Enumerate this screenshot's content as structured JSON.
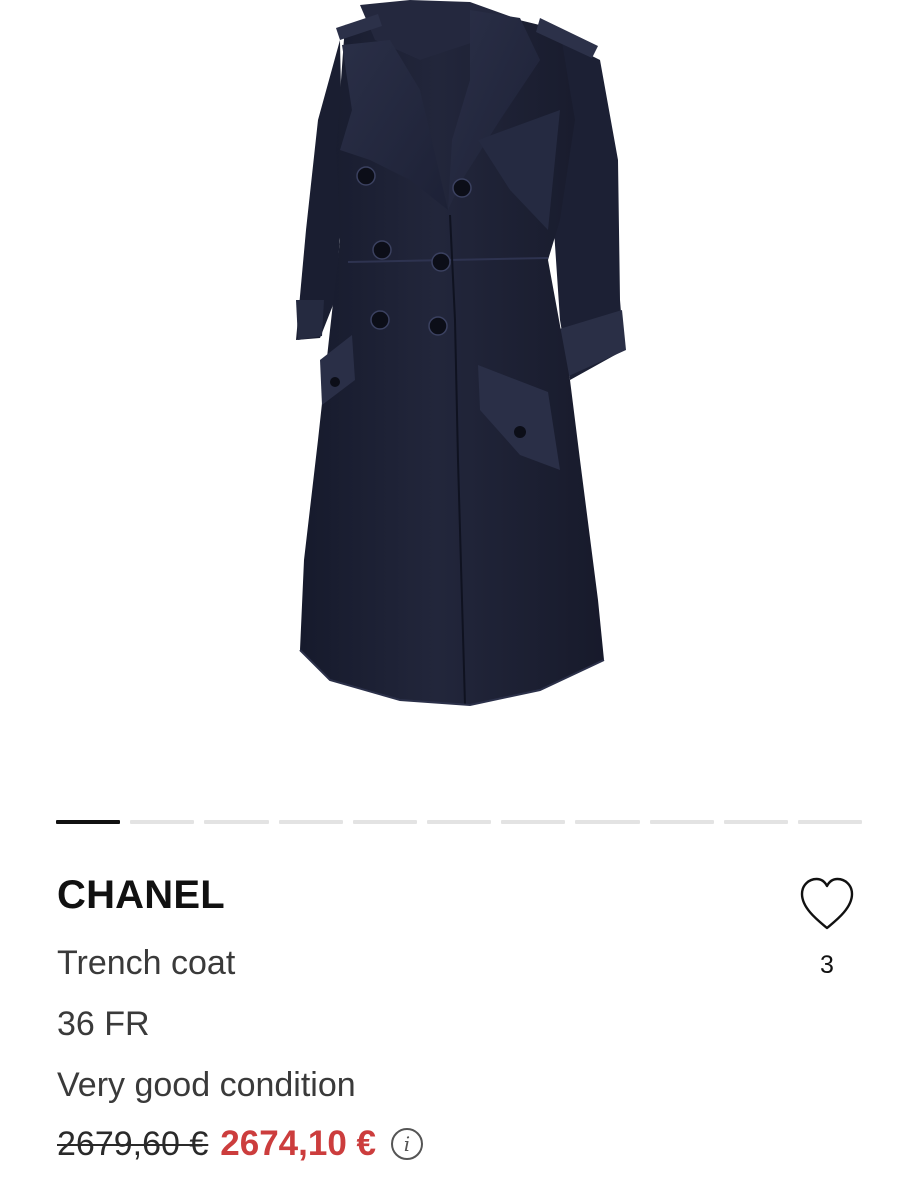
{
  "gallery": {
    "image_alt": "Navy double-breasted trench coat on mannequin",
    "slide_count": 11,
    "active_slide": 1,
    "coat_color": "#1b1f33"
  },
  "product": {
    "brand": "CHANEL",
    "title": "Trench coat",
    "size": "36 FR",
    "condition": "Very good condition",
    "original_price": "2679,60 €",
    "price": "2674,10 €",
    "price_color": "#cc3d3d",
    "info_icon": "info-icon"
  },
  "favorite": {
    "icon": "heart-outline-icon",
    "count": "3"
  }
}
